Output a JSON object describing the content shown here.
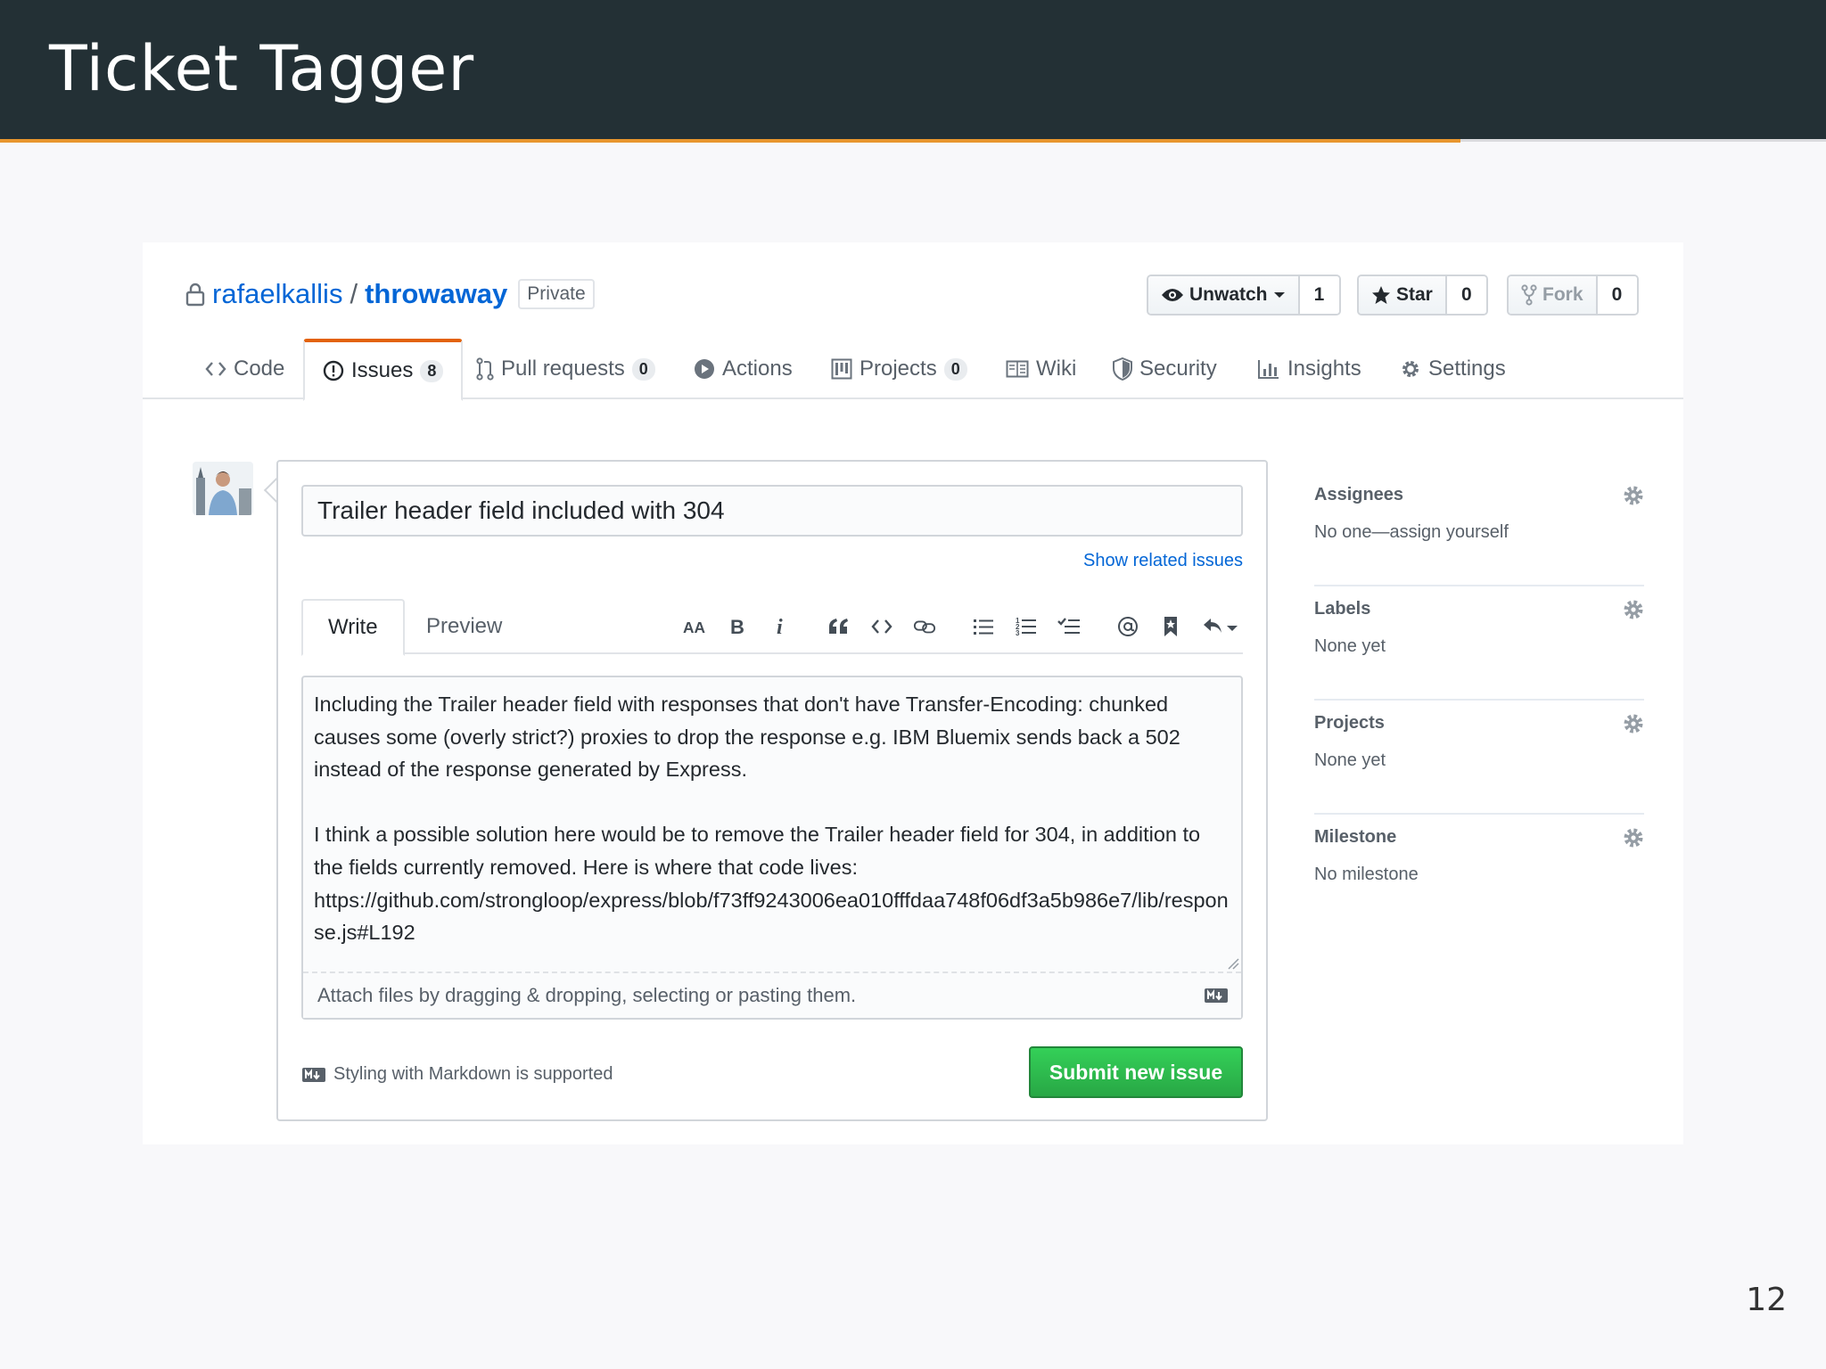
{
  "slide": {
    "title": "Ticket Tagger",
    "page_number": "12"
  },
  "repo": {
    "owner": "rafaelkallis",
    "separator": "/",
    "name": "throwaway",
    "visibility": "Private",
    "unwatch_label": "Unwatch",
    "unwatch_count": "1",
    "star_label": "Star",
    "star_count": "0",
    "fork_label": "Fork",
    "fork_count": "0"
  },
  "tabs": [
    {
      "label": "Code",
      "icon": "code-icon"
    },
    {
      "label": "Issues",
      "count": "8",
      "icon": "issue-icon",
      "selected": true
    },
    {
      "label": "Pull requests",
      "count": "0",
      "icon": "pull-request-icon"
    },
    {
      "label": "Actions",
      "icon": "play-icon"
    },
    {
      "label": "Projects",
      "count": "0",
      "icon": "project-icon"
    },
    {
      "label": "Wiki",
      "icon": "book-icon"
    },
    {
      "label": "Security",
      "icon": "shield-icon"
    },
    {
      "label": "Insights",
      "icon": "graph-icon"
    },
    {
      "label": "Settings",
      "icon": "gear-icon"
    }
  ],
  "issue_form": {
    "title_value": "Trailer header field included with 304",
    "related_link": "Show related issues",
    "write_tab": "Write",
    "preview_tab": "Preview",
    "body": "Including the Trailer header field with responses that don't have Transfer-Encoding: chunked causes some (overly strict?) proxies to drop the response e.g. IBM Bluemix sends back a 502 instead of the response generated by Express.\n\nI think a possible solution here would be to remove the Trailer header field for 304, in addition to the fields currently removed. Here is where that code lives: https://github.com/strongloop/express/blob/f73ff9243006ea010fffdaa748f06df3a5b986e7/lib/response.js#L192",
    "attach_hint": "Attach files by dragging & dropping, selecting or pasting them.",
    "markdown_note": "Styling with Markdown is supported",
    "submit_label": "Submit new issue",
    "submit_color": "#28a745"
  },
  "sidebar": {
    "assignees": {
      "title": "Assignees",
      "value": "No one—assign yourself"
    },
    "labels": {
      "title": "Labels",
      "value": "None yet"
    },
    "projects": {
      "title": "Projects",
      "value": "None yet"
    },
    "milestone": {
      "title": "Milestone",
      "value": "No milestone"
    }
  },
  "colors": {
    "header_bg": "#233035",
    "accent": "#e8962e",
    "link": "#0366d6",
    "selected_tab_border": "#e36209"
  }
}
